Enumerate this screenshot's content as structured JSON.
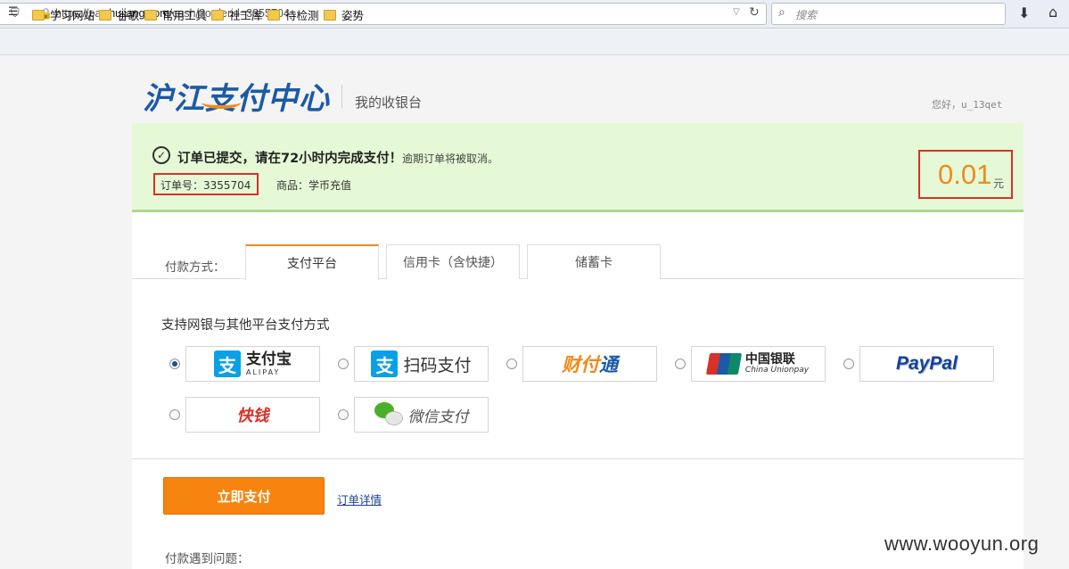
{
  "browser": {
    "url_prefix": "https://pay.",
    "url_domain": "hujiang.com",
    "url_path": "/cash/?orderid=3355704",
    "search_placeholder": "搜索",
    "bookmarks": [
      "学习网站",
      "谷歌",
      "常用工具",
      "社工库",
      "待检测",
      "姿势"
    ]
  },
  "header": {
    "logo_text": "沪江支付中心",
    "subtitle": "我的收银台",
    "greeting": "您好，u_13qet"
  },
  "notice": {
    "message": "订单已提交，请在72小时内完成支付！",
    "submessage": "逾期订单将被取消。",
    "order_no": "订单号：3355704",
    "product": "商品：学币充值",
    "amount": "0.01",
    "amount_unit": "元"
  },
  "payment": {
    "label": "付款方式：",
    "tabs": [
      "支付平台",
      "信用卡（含快捷）",
      "储蓄卡"
    ],
    "active_tab": 0,
    "section_title": "支持网银与其他平台支付方式",
    "methods": {
      "alipay_cn": "支付宝",
      "alipay_en": "ALIPAY",
      "scan": "扫码支付",
      "tenpay_a": "财付",
      "tenpay_b": "通",
      "unionpay_cn": "中国银联",
      "unionpay_en": "China Unionpay",
      "paypal": "PayPal",
      "kuaiqian": "快钱",
      "wechat": "微信支付"
    },
    "pay_button": "立即支付",
    "detail_link": "订单详情",
    "problem_label": "付款遇到问题："
  },
  "watermark": "www.wooyun.org",
  "colors": {
    "accent": "#f7840f",
    "brand": "#1b5aa6",
    "notice_bg": "#e6f9d6",
    "highlight": "#d9302a"
  }
}
